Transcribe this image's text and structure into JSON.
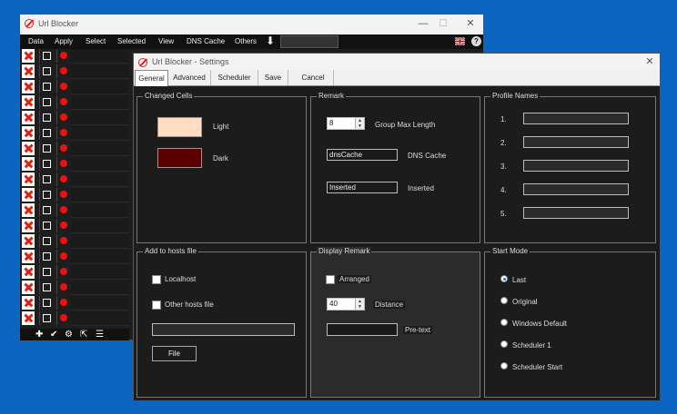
{
  "main": {
    "title": "Url Blocker",
    "menu": [
      "Data",
      "Apply",
      "Select",
      "Selected",
      "View",
      "DNS Cache",
      "Others"
    ],
    "flag_icon": "uk-flag-icon",
    "help_icon": "help-icon"
  },
  "settings": {
    "title": "Url Blocker - Settings",
    "tabs": [
      "General",
      "Advanced",
      "Scheduler",
      "Save",
      "Cancel"
    ],
    "changed_cells": {
      "title": "Changed Cells",
      "light_label": "Light",
      "dark_label": "Dark",
      "light_color": "#ffdcc2",
      "dark_color": "#5a0000"
    },
    "remark": {
      "title": "Remark",
      "group_max_value": "8",
      "group_max_label": "Group Max Length",
      "dns_value": "dnsCache",
      "dns_label": "DNS Cache",
      "inserted_value": "Inserted",
      "inserted_label": "Inserted"
    },
    "profile_names": {
      "title": "Profile Names",
      "numbers": [
        "1.",
        "2.",
        "3.",
        "4.",
        "5."
      ]
    },
    "hosts": {
      "title": "Add to hosts file",
      "localhost": "Localhost",
      "other": "Other hosts file",
      "file_button": "File"
    },
    "display_remark": {
      "title": "Display Remark",
      "arranged": "Arranged",
      "distance_value": "40",
      "distance_label": "Distance",
      "pretext_label": "Pre-text"
    },
    "start_mode": {
      "title": "Start Mode",
      "options": [
        "Last",
        "Original",
        "Windows Default",
        "Scheduler 1",
        "Scheduler Start"
      ],
      "selected": "Last"
    }
  }
}
